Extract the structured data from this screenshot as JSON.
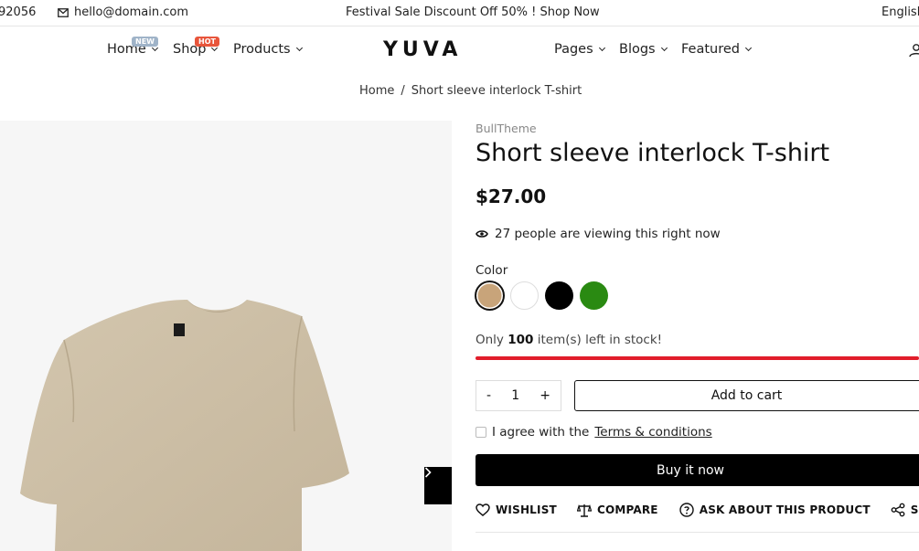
{
  "topbar": {
    "phone": "92056",
    "email": "hello@domain.com",
    "promo": "Festival Sale Discount Off 50% ! Shop Now",
    "language": "English"
  },
  "nav": {
    "logo": "YUVA",
    "items": [
      {
        "label": "Home",
        "badge": "NEW"
      },
      {
        "label": "Shop",
        "badge": "HOT"
      },
      {
        "label": "Products"
      },
      {
        "label": "Pages"
      },
      {
        "label": "Blogs"
      },
      {
        "label": "Featured"
      }
    ]
  },
  "breadcrumb": {
    "home": "Home",
    "separator": "/",
    "current": "Short sleeve interlock T-shirt"
  },
  "product": {
    "vendor": "BullTheme",
    "title": "Short sleeve interlock T-shirt",
    "price": "$27.00",
    "viewing": "27 people are viewing this right now",
    "color_label": "Color",
    "colors": [
      "#c8a47a",
      "#ffffff",
      "#000000",
      "#2a8a12"
    ],
    "selected_color_index": 0,
    "stock_prefix": "Only",
    "stock_count": "100",
    "stock_suffix": "item(s) left in stock!",
    "quantity": "1",
    "qty_minus": "-",
    "qty_plus": "+",
    "add_to_cart": "Add to cart",
    "agree_text": "I agree with the",
    "terms_link": "Terms & conditions",
    "buy_now": "Buy it now",
    "actions": {
      "wishlist": "WISHLIST",
      "compare": "COMPARE",
      "ask": "ASK ABOUT THIS PRODUCT",
      "share": "SHARE"
    }
  },
  "colors": {
    "accent_red": "#e11d2b",
    "tshirt": "#cdbfa6",
    "badge_new": "#9fb3c8",
    "badge_hot": "#e8553b"
  }
}
